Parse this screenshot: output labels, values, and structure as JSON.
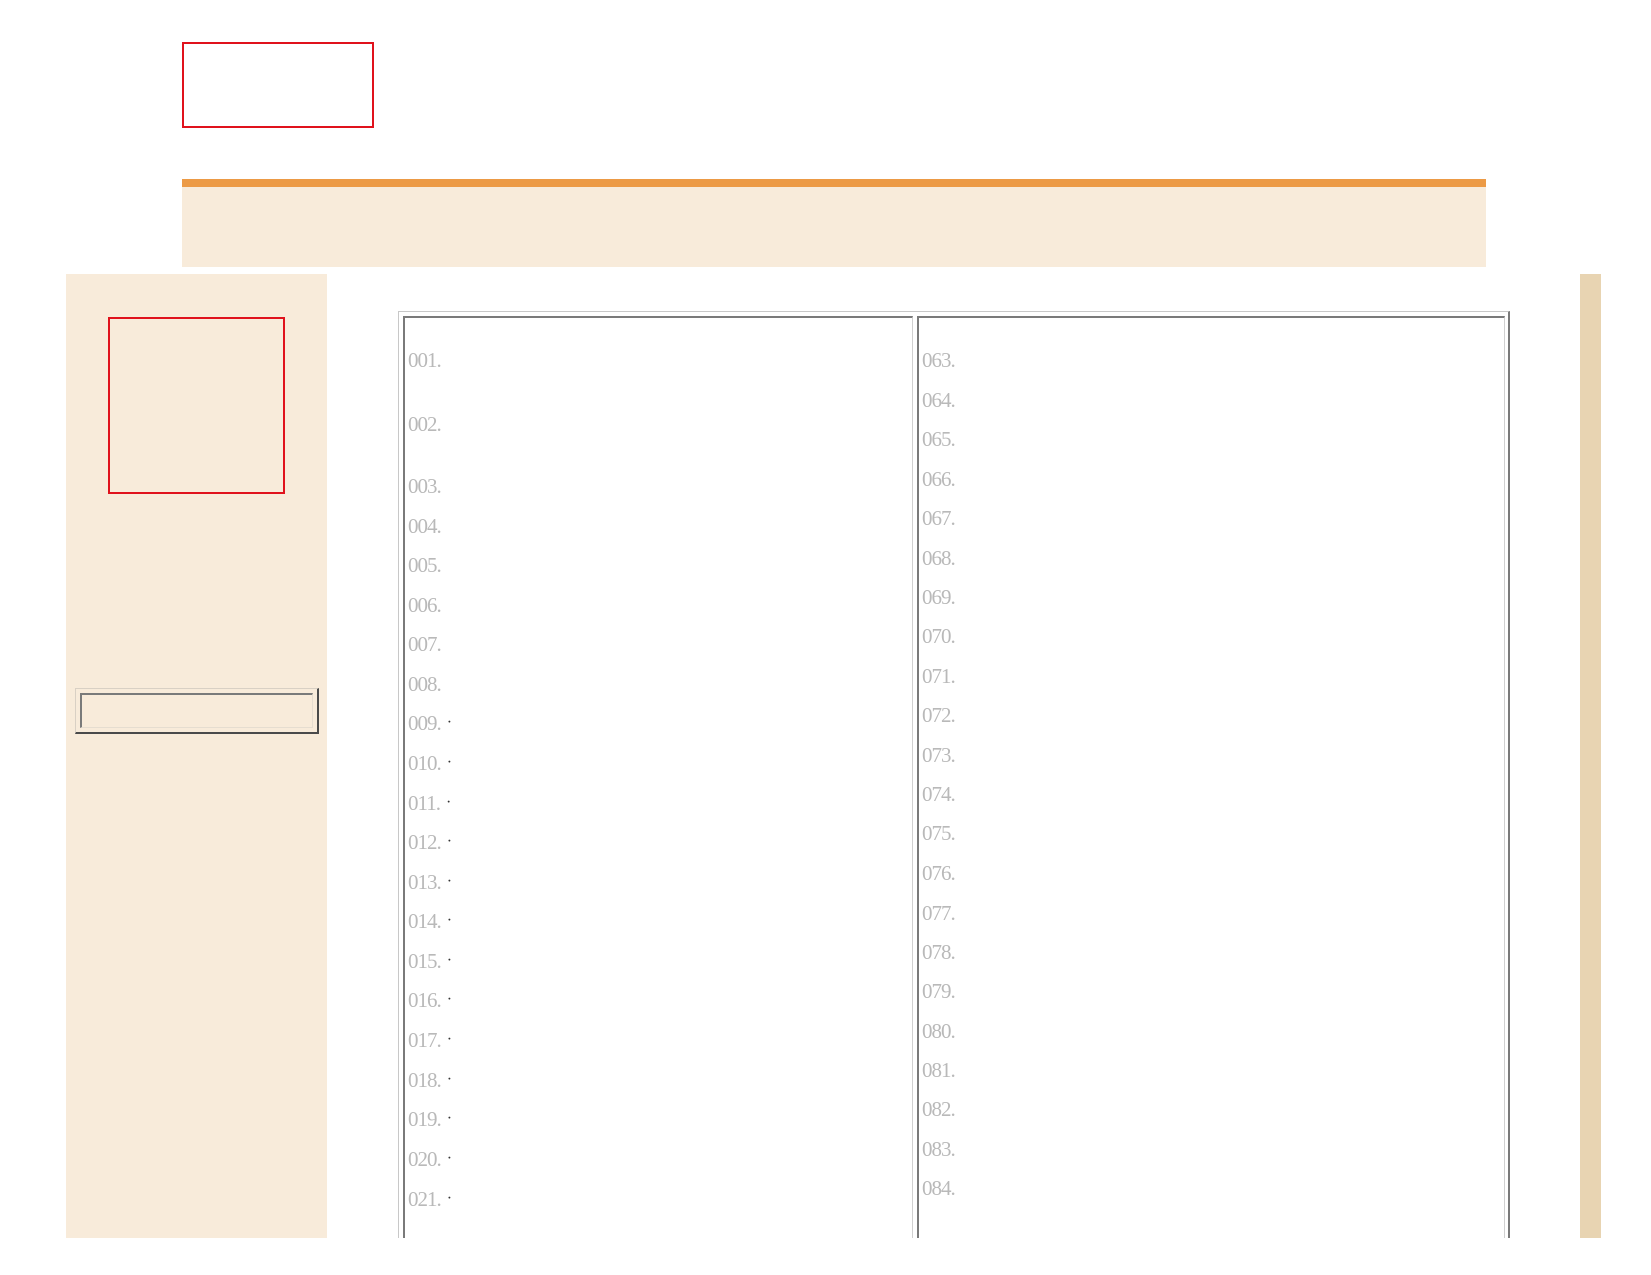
{
  "list": {
    "left": [
      {
        "label": "001.",
        "bullet": ""
      },
      {
        "label": "002.",
        "bullet": ""
      },
      {
        "label": "003.",
        "bullet": ""
      },
      {
        "label": "004.",
        "bullet": ""
      },
      {
        "label": "005.",
        "bullet": ""
      },
      {
        "label": "006.",
        "bullet": ""
      },
      {
        "label": "007.",
        "bullet": ""
      },
      {
        "label": "008.",
        "bullet": ""
      },
      {
        "label": "009.",
        "bullet": "·"
      },
      {
        "label": "010.",
        "bullet": "·"
      },
      {
        "label": "011.",
        "bullet": "·"
      },
      {
        "label": "012.",
        "bullet": "·"
      },
      {
        "label": "013.",
        "bullet": "·"
      },
      {
        "label": "014.",
        "bullet": "·"
      },
      {
        "label": "015.",
        "bullet": "·"
      },
      {
        "label": "016.",
        "bullet": "·"
      },
      {
        "label": "017.",
        "bullet": "·"
      },
      {
        "label": "018.",
        "bullet": "·"
      },
      {
        "label": "019.",
        "bullet": "·"
      },
      {
        "label": "020.",
        "bullet": "·"
      },
      {
        "label": "021.",
        "bullet": "·"
      }
    ],
    "right": [
      {
        "label": "063."
      },
      {
        "label": "064."
      },
      {
        "label": "065."
      },
      {
        "label": "066."
      },
      {
        "label": "067."
      },
      {
        "label": "068."
      },
      {
        "label": "069."
      },
      {
        "label": "070."
      },
      {
        "label": "071."
      },
      {
        "label": "072."
      },
      {
        "label": "073."
      },
      {
        "label": "074."
      },
      {
        "label": "075."
      },
      {
        "label": "076."
      },
      {
        "label": "077."
      },
      {
        "label": "078."
      },
      {
        "label": "079."
      },
      {
        "label": "080."
      },
      {
        "label": "081."
      },
      {
        "label": "082."
      },
      {
        "label": "083."
      },
      {
        "label": "084."
      }
    ]
  },
  "colors": {
    "accent_orange": "#ec9a45",
    "band_beige": "#f8ebda",
    "strip_tan": "#e8d4b2",
    "placeholder_red": "#e0121c",
    "item_gray": "#b9b9b9"
  }
}
